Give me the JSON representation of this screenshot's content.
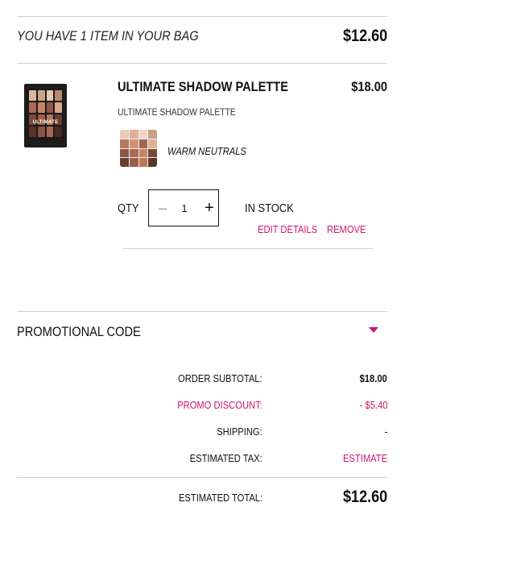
{
  "bag": {
    "title": "YOU HAVE 1 ITEM IN YOUR BAG",
    "total": "$12.60"
  },
  "item": {
    "name": "ULTIMATE SHADOW PALETTE",
    "price": "$18.00",
    "subtitle": "ULTIMATE SHADOW PALETTE",
    "thumbnail_label": "ULTIMATE",
    "shade": "WARM NEUTRALS",
    "qty_label": "QTY",
    "quantity": "1",
    "stock": "IN STOCK",
    "edit_label": "EDIT DETAILS",
    "remove_label": "REMOVE"
  },
  "promo": {
    "label": "PROMOTIONAL CODE"
  },
  "summary": {
    "subtotal_label": "ORDER SUBTOTAL:",
    "subtotal_value": "$18.00",
    "discount_label": "PROMO DISCOUNT:",
    "discount_value": "- $5.40",
    "shipping_label": "SHIPPING:",
    "shipping_value": "-",
    "tax_label": "ESTIMATED TAX:",
    "tax_value": "ESTIMATE",
    "total_label": "ESTIMATED TOTAL:",
    "total_value": "$12.60"
  },
  "colors": {
    "accent": "#d01373",
    "divider": "#cfcfcf"
  },
  "icons": {
    "qty_minus": "minus-icon",
    "qty_plus": "plus-icon",
    "promo_toggle": "caret-down-icon"
  }
}
